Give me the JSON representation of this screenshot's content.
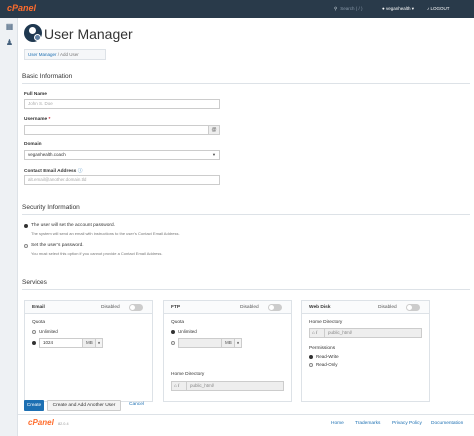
{
  "topbar": {
    "logo": "cPanel",
    "search_placeholder": "Search ( / )",
    "search_icon": "search-icon",
    "user": "veganhealth",
    "logout": "LOGOUT"
  },
  "rail": {
    "icons": [
      "grid-icon",
      "users-icon"
    ]
  },
  "page": {
    "title": "User Manager",
    "breadcrumb_link": "User Manager",
    "breadcrumb_current": "Add User"
  },
  "basic": {
    "heading": "Basic Information",
    "full_name_label": "Full Name",
    "full_name_placeholder": "John S. Doe",
    "username_label": "Username",
    "domain_label": "Domain",
    "domain_value": "veganhealth.coach",
    "email_label": "Contact Email Address",
    "email_placeholder": "alt.email@another.domain.tld"
  },
  "security": {
    "heading": "Security Information",
    "opt1": "The user will set the account password.",
    "opt1_note": "The system will send an email with instructions to the user’s Contact Email Address.",
    "opt2": "Set the user’s password.",
    "opt2_note": "You must select this option if you cannot provide a Contact Email Address."
  },
  "services": {
    "heading": "Services",
    "email": {
      "title": "Email",
      "state": "Disabled",
      "quota_label": "Quota",
      "unlimited": "Unlimited",
      "quota_value": "1024",
      "unit": "MB"
    },
    "ftp": {
      "title": "FTP",
      "state": "Disabled",
      "quota_label": "Quota",
      "unlimited": "Unlimited",
      "quota_value": "",
      "unit": "MB",
      "home_label": "Home Directory",
      "home_prefix": "/",
      "home_value": "public_html/"
    },
    "webdisk": {
      "title": "Web Disk",
      "state": "Disabled",
      "home_label": "Home Directory",
      "home_prefix": "/",
      "home_value": "public_html/",
      "perm_label": "Permissions",
      "perm1": "Read-Write",
      "perm2": "Read-Only"
    }
  },
  "actions": {
    "create": "Create",
    "create_another": "Create and Add Another User",
    "cancel": "Cancel"
  },
  "footer": {
    "logo": "cPanel",
    "version": "82.0.4",
    "links": [
      "Home",
      "Trademarks",
      "Privacy Policy",
      "Documentation"
    ]
  },
  "colors": {
    "accent": "#1c6fb2",
    "brand": "#ff6c2c",
    "topbar": "#293a4a"
  }
}
